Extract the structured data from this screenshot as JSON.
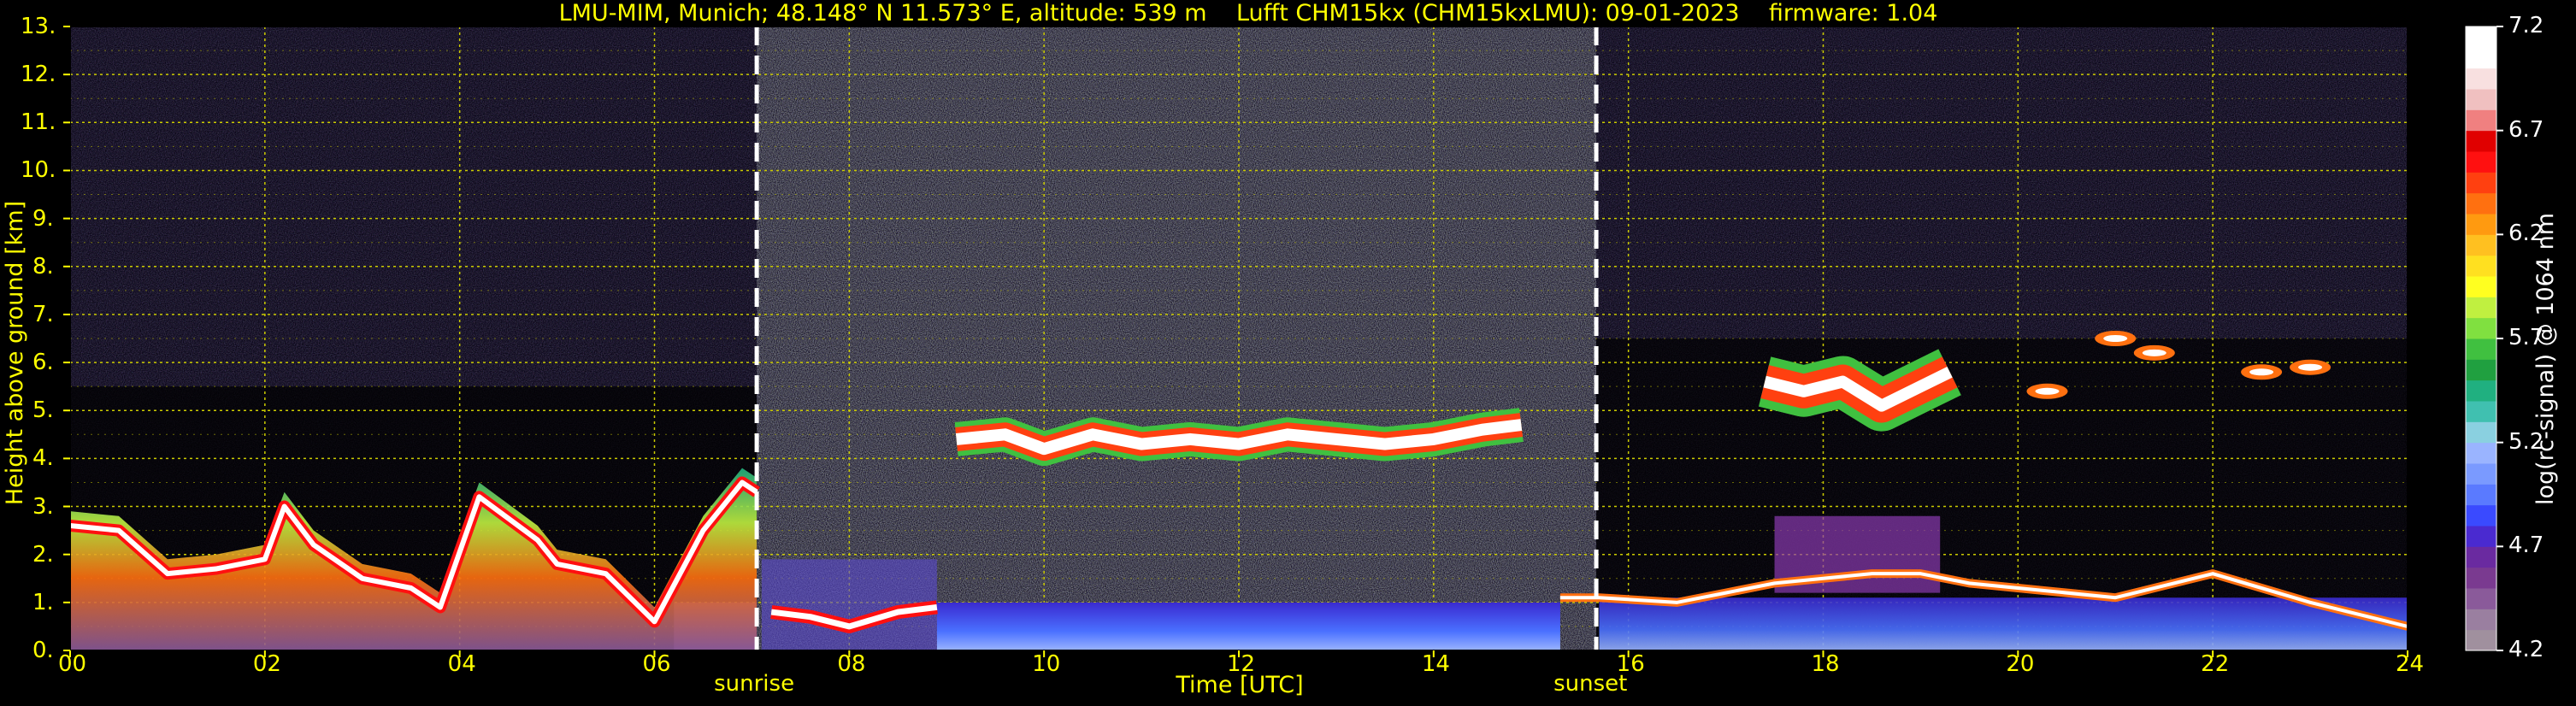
{
  "title": "LMU-MIM, Munich; 48.148° N 11.573° E, altitude: 539 m    Lufft CHM15kx (CHM15kxLMU): 09-01-2023    firmware: 1.04",
  "colors": {
    "axis_text": "#ffff00",
    "grid": "#cccc00",
    "background": "#000000",
    "sun_lines": "#ffffff"
  },
  "chart_data": {
    "type": "heatmap",
    "title": "LMU-MIM, Munich; 48.148° N 11.573° E, altitude: 539 m    Lufft CHM15kx (CHM15kxLMU): 09-01-2023    firmware: 1.04",
    "xlabel": "Time [UTC]",
    "ylabel": "Height above ground [km]",
    "xlim": [
      0,
      24
    ],
    "ylim": [
      0,
      13
    ],
    "x_ticks": [
      "00",
      "02",
      "04",
      "06",
      "08",
      "10",
      "12",
      "14",
      "16",
      "18",
      "20",
      "22",
      "24"
    ],
    "x_tick_values": [
      0,
      2,
      4,
      6,
      8,
      10,
      12,
      14,
      16,
      18,
      20,
      22,
      24
    ],
    "y_ticks": [
      "0.",
      "1.",
      "2.",
      "3.",
      "4.",
      "5.",
      "6.",
      "7.",
      "8.",
      "9.",
      "10.",
      "11.",
      "12.",
      "13."
    ],
    "y_tick_values": [
      0,
      1,
      2,
      3,
      4,
      5,
      6,
      7,
      8,
      9,
      10,
      11,
      12,
      13
    ],
    "grid": true,
    "annotations": [
      {
        "label": "sunrise",
        "x": 7.05
      },
      {
        "label": "sunset",
        "x": 15.67
      }
    ],
    "colorbar": {
      "label": "log(rc-signal) @ 1064 nm",
      "ticks": [
        "4.2",
        "4.7",
        "5.2",
        "5.7",
        "6.2",
        "6.7",
        "7.2"
      ],
      "tick_values": [
        4.2,
        4.7,
        5.2,
        5.7,
        6.2,
        6.7,
        7.2
      ],
      "range": [
        4.2,
        7.2
      ],
      "colors": [
        "#a0909e",
        "#9a7fa0",
        "#8a5a9a",
        "#7a3a90",
        "#6a2aa0",
        "#4a2ad0",
        "#3a4aff",
        "#5a7aff",
        "#7a9aff",
        "#9ab4ff",
        "#8ad0e0",
        "#40c0b0",
        "#20b080",
        "#20a040",
        "#40c040",
        "#80e040",
        "#c0f040",
        "#ffff20",
        "#ffe020",
        "#ffc020",
        "#ff9a10",
        "#ff7010",
        "#ff4010",
        "#ff1010",
        "#e00000",
        "#f08080",
        "#f0c0c0",
        "#f8e0e0",
        "#ffffff",
        "#ffffff"
      ]
    },
    "features": {
      "boundary_layer": [
        [
          0,
          2.6
        ],
        [
          0.5,
          2.5
        ],
        [
          1,
          1.6
        ],
        [
          1.5,
          1.7
        ],
        [
          2,
          1.9
        ],
        [
          2.2,
          3.0
        ],
        [
          2.5,
          2.2
        ],
        [
          3,
          1.5
        ],
        [
          3.5,
          1.3
        ],
        [
          3.8,
          0.9
        ],
        [
          4.2,
          3.2
        ],
        [
          4.8,
          2.3
        ],
        [
          5,
          1.8
        ],
        [
          5.5,
          1.6
        ],
        [
          6,
          0.6
        ],
        [
          6.5,
          2.5
        ],
        [
          6.9,
          3.5
        ],
        [
          7.05,
          3.3
        ]
      ],
      "morning_residual_layer": [
        [
          7.2,
          0.8
        ],
        [
          7.6,
          0.7
        ],
        [
          8,
          0.5
        ],
        [
          8.5,
          0.8
        ],
        [
          8.9,
          0.9
        ]
      ],
      "midday_cloud_layer": [
        [
          9.1,
          4.4
        ],
        [
          9.6,
          4.5
        ],
        [
          10,
          4.2
        ],
        [
          10.5,
          4.5
        ],
        [
          11,
          4.3
        ],
        [
          11.5,
          4.4
        ],
        [
          12,
          4.3
        ],
        [
          12.5,
          4.5
        ],
        [
          13,
          4.4
        ],
        [
          13.5,
          4.3
        ],
        [
          14,
          4.4
        ],
        [
          14.5,
          4.6
        ],
        [
          14.9,
          4.7
        ]
      ],
      "evening_boundary_layer": [
        [
          15.3,
          1.1
        ],
        [
          15.7,
          1.1
        ],
        [
          16.5,
          1.0
        ],
        [
          17,
          1.2
        ],
        [
          17.5,
          1.4
        ],
        [
          18,
          1.5
        ],
        [
          18.5,
          1.6
        ],
        [
          19,
          1.6
        ],
        [
          19.5,
          1.4
        ],
        [
          20,
          1.3
        ],
        [
          21,
          1.1
        ],
        [
          22,
          1.6
        ],
        [
          23,
          1.0
        ],
        [
          24,
          0.5
        ]
      ],
      "evening_cloud": [
        [
          17.4,
          5.6
        ],
        [
          17.8,
          5.4
        ],
        [
          18.2,
          5.6
        ],
        [
          18.6,
          5.1
        ],
        [
          19,
          5.5
        ],
        [
          19.3,
          5.8
        ]
      ],
      "small_clouds": [
        [
          20.3,
          5.4
        ],
        [
          21.0,
          6.5
        ],
        [
          21.4,
          6.2
        ],
        [
          22.5,
          5.8
        ],
        [
          23.0,
          5.9
        ]
      ]
    }
  }
}
